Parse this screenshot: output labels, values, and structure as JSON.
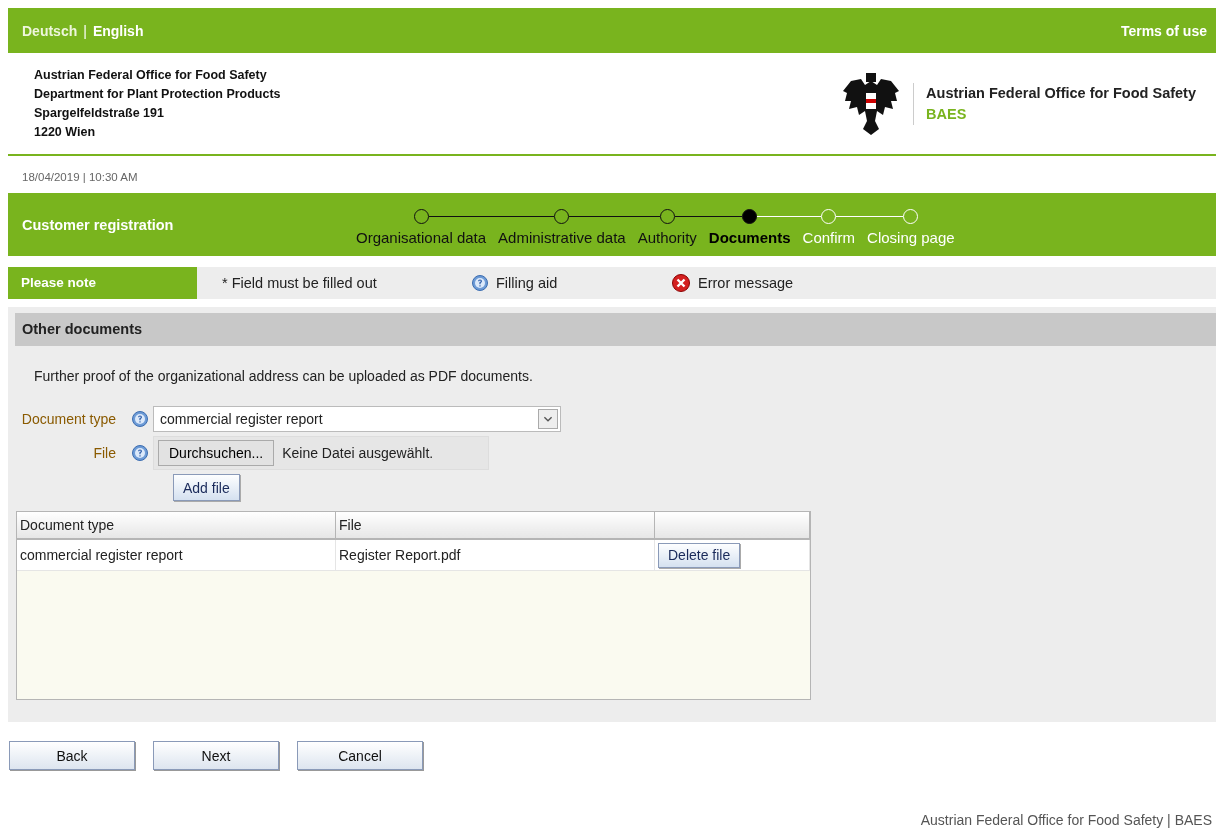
{
  "top_bar": {
    "languages": [
      {
        "label": "Deutsch",
        "selected": false
      },
      {
        "label": "English",
        "selected": true
      }
    ],
    "separator": "|",
    "terms": "Terms of use"
  },
  "header": {
    "address": [
      "Austrian Federal Office for Food Safety",
      "Department for Plant Protection Products",
      "Spargelfeldstraße 191",
      "1220 Wien"
    ],
    "org_name": "Austrian Federal Office for Food Safety",
    "org_short": "BAES"
  },
  "timestamp": "18/04/2019 | 10:30 AM",
  "wizard": {
    "title": "Customer registration",
    "steps": [
      {
        "label": "Organisational data",
        "completed": true,
        "selected": false
      },
      {
        "label": "Administrative data",
        "completed": true,
        "selected": false
      },
      {
        "label": "Authority",
        "completed": true,
        "selected": false
      },
      {
        "label": "Documents",
        "completed": false,
        "selected": true
      },
      {
        "label": "Confirm",
        "completed": false,
        "selected": false
      },
      {
        "label": "Closing page",
        "completed": false,
        "selected": false
      }
    ]
  },
  "note_bar": {
    "title": "Please note",
    "required": "* Field must be filled out",
    "aid": "Filling aid",
    "error": "Error message"
  },
  "section": {
    "title": "Other documents",
    "intro": "Further proof of the organizational address can be uploaded as PDF documents.",
    "document_type": {
      "label": "Document type",
      "value": "commercial register report"
    },
    "file": {
      "label": "File",
      "browse": "Durchsuchen...",
      "status": "Keine Datei ausgewählt."
    },
    "add_button": "Add file",
    "table": {
      "columns": [
        "Document type",
        "File"
      ],
      "rows": [
        {
          "cells": [
            "commercial register report",
            "Register Report.pdf"
          ],
          "action": "Delete file"
        }
      ]
    }
  },
  "buttons": [
    "Back",
    "Next",
    "Cancel"
  ],
  "footer": "Austrian Federal Office for Food Safety | BAES"
}
